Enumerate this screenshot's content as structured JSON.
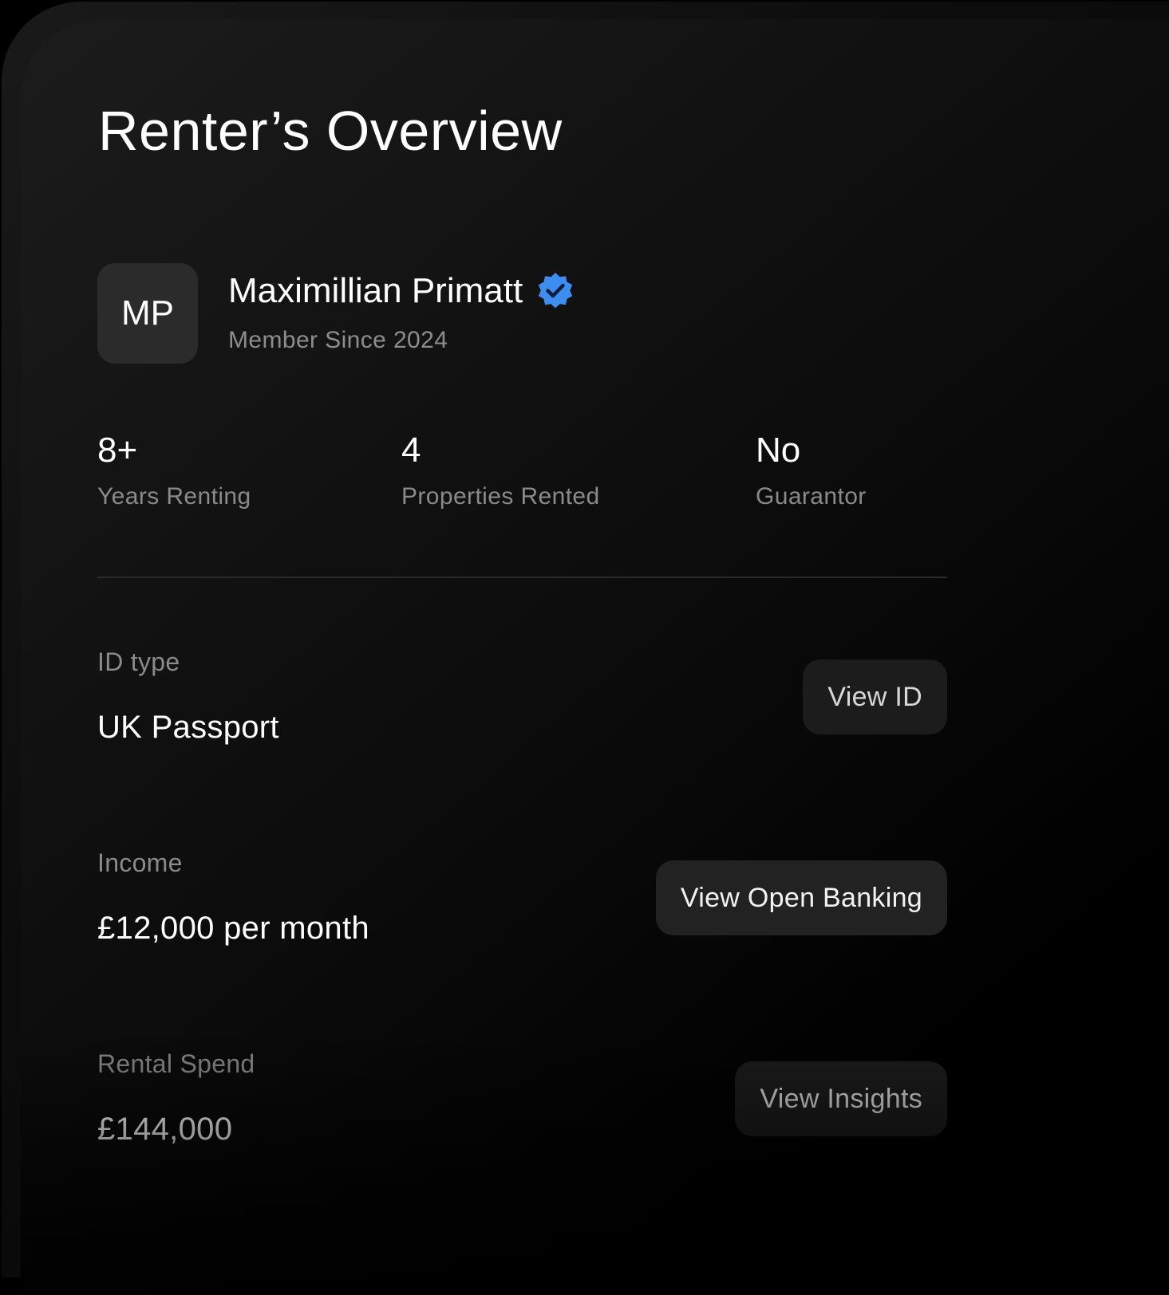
{
  "header": {
    "title": "Renter’s Overview"
  },
  "profile": {
    "initials": "MP",
    "name": "Maximillian Primatt",
    "member_since": "Member Since 2024",
    "verified_icon": "verified-badge-icon",
    "verified_color": "#3d8ef0"
  },
  "stats": [
    {
      "value": "8+",
      "label": "Years Renting"
    },
    {
      "value": "4",
      "label": "Properties Rented"
    },
    {
      "value": "No",
      "label": "Guarantor"
    }
  ],
  "details": {
    "id": {
      "label": "ID type",
      "value": "UK Passport",
      "button": "View ID"
    },
    "income": {
      "label": "Income",
      "value": "£12,000 per month",
      "button": "View Open Banking"
    },
    "rental_spend": {
      "label": "Rental Spend",
      "value": "£144,000",
      "button": "View Insights"
    }
  }
}
